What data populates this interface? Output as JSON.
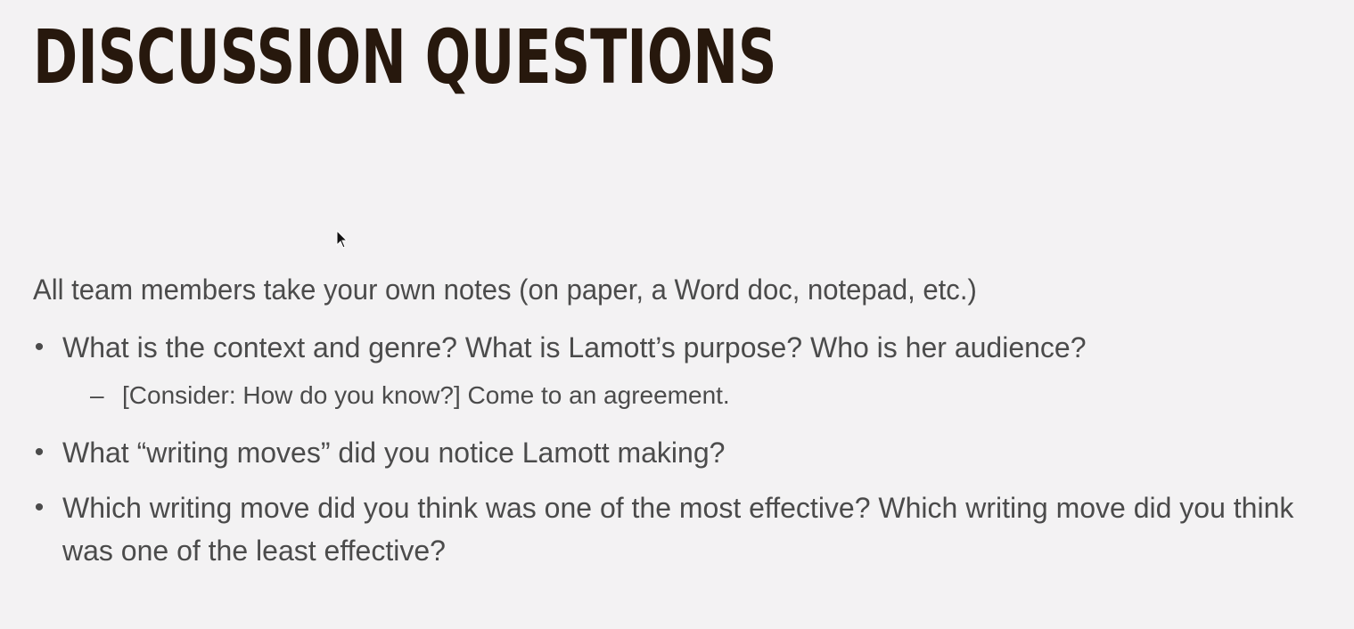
{
  "slide": {
    "title": "DISCUSSION QUESTIONS",
    "intro": "All team members take your own notes (on paper, a Word doc, notepad, etc.)",
    "bullets": [
      {
        "text": "What is the context and genre? What is Lamott’s purpose? Who is her audience?",
        "sub": "[Consider: How do you know?] Come to an agreement."
      },
      {
        "text": "What “writing moves” did you notice Lamott making?"
      },
      {
        "text": "Which writing move did you think was one of the most effective? Which writing move did you think was one of the least effective?"
      }
    ]
  },
  "colors": {
    "background": "#f3f2f3",
    "title": "#27180d",
    "body_text": "#4b4b4b"
  },
  "icons": {
    "pointer": "mouse-pointer-icon"
  }
}
